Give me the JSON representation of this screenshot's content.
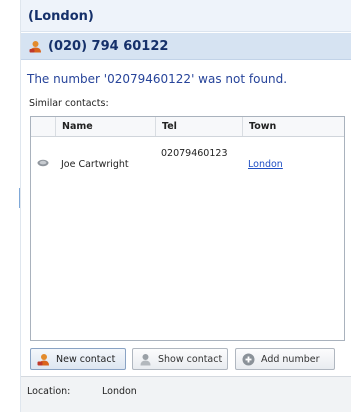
{
  "header": {
    "title": "(London)"
  },
  "phone": {
    "number": "(020) 794 60122",
    "icon": "phone-person-icon"
  },
  "message": {
    "not_found": "The number '02079460122' was not found."
  },
  "similar": {
    "label": "Similar contacts:",
    "columns": [
      "",
      "Name",
      "Tel",
      "Town"
    ],
    "rows": [
      {
        "icon": "contact-card-icon",
        "name": "Joe Cartwright",
        "tel": "02079460123",
        "town": "London"
      }
    ]
  },
  "actions": {
    "new_contact": "New contact",
    "show_contact": "Show contact",
    "add_number": "Add number"
  },
  "footer": {
    "label": "Location:",
    "value": "London"
  },
  "colors": {
    "accent": "#15306a",
    "link": "#1f4fc4",
    "message": "#27449a",
    "phone_bar": "#d6e3f2"
  }
}
